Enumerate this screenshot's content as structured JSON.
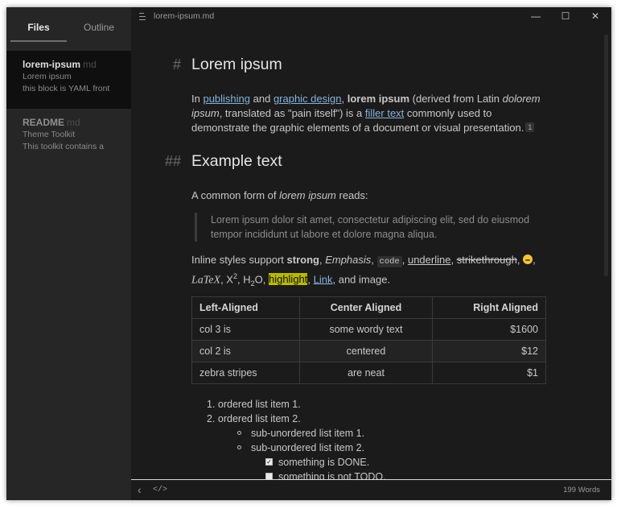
{
  "sidebar": {
    "tabs": [
      "Files",
      "Outline"
    ],
    "files": [
      {
        "name": "lorem-ipsum",
        "ext": "md",
        "lines": [
          "Lorem ipsum",
          "this block is YAML front"
        ]
      },
      {
        "name": "README",
        "ext": "md",
        "lines": [
          "Theme Toolkit",
          "This toolkit contains a"
        ]
      }
    ]
  },
  "titlebar": {
    "title": "lorem-ipsum.md",
    "minimize": "—",
    "maximize": "☐",
    "close": "✕"
  },
  "doc": {
    "h1": {
      "mark": "#",
      "text": "Lorem ipsum"
    },
    "intro": {
      "t1": "In ",
      "link1": "publishing",
      "t2": " and ",
      "link2": "graphic design",
      "t3": ", ",
      "bold": "lorem ipsum",
      "t4": " (derived from Latin ",
      "em1": "dolorem ipsum",
      "t5": ", translated as \"pain itself\") is a ",
      "link3": "filler text",
      "t6": " commonly used to demonstrate the graphic elements of a document or visual presentation.",
      "footnote": "1"
    },
    "h2": {
      "mark": "##",
      "text": "Example text"
    },
    "common": {
      "t1": "A common form of ",
      "em": "lorem ipsum",
      "t2": " reads:"
    },
    "quote": "Lorem ipsum dolor sit amet, consectetur adipiscing elit, sed do eiusmod tempor incididunt ut labore et dolore magna aliqua.",
    "inline": {
      "t1": "Inline styles support ",
      "strong": "strong",
      "c1": ", ",
      "em": "Emphasis",
      "c2": ", ",
      "code": "code",
      "c3": ", ",
      "underline": "underline",
      "c4": ", ",
      "strike": "strikethrough",
      "c5": ", ",
      "c6": ",",
      "latex": "LaTeX",
      "c7": ", X",
      "sup": "2",
      "c8": ", H",
      "sub": "2",
      "c9": "O, ",
      "highlight": "highlight",
      "c10": ", ",
      "link": "Link",
      "c11": ", and image."
    },
    "table": {
      "headers": [
        "Left-Aligned",
        "Center Aligned",
        "Right Aligned"
      ],
      "rows": [
        [
          "col 3 is",
          "some wordy text",
          "$1600"
        ],
        [
          "col 2 is",
          "centered",
          "$12"
        ],
        [
          "zebra stripes",
          "are neat",
          "$1"
        ]
      ]
    },
    "ordered": [
      "1. ordered list item 1.",
      "2. ordered list item 2."
    ],
    "unordered": [
      "sub-unordered list item 1.",
      "sub-unordered list item 2."
    ],
    "tasks": [
      {
        "text": "something is DONE.",
        "checked": true
      },
      {
        "text": "something is not TODO.",
        "checked": false
      }
    ]
  },
  "statusbar": {
    "back": "‹",
    "source": "</>",
    "words": "199 Words"
  },
  "colors": {
    "background": "#1b1b1b",
    "sidebar": "#262626",
    "link": "#84b3dc",
    "highlight": "#b8b800"
  }
}
